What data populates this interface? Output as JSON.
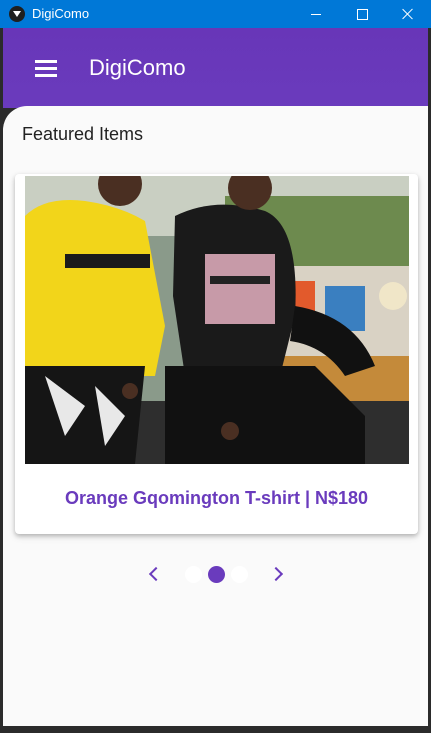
{
  "window": {
    "title": "DigiComo"
  },
  "appbar": {
    "title": "DigiComo",
    "menu_icon": "hamburger-menu-icon"
  },
  "section": {
    "title": "Featured Items"
  },
  "carousel": {
    "item_caption": "Orange Gqomington T-shirt | N$180",
    "total_dots": 3,
    "active_index": 1,
    "prev_icon": "chevron-left-icon",
    "next_icon": "chevron-right-icon"
  },
  "colors": {
    "titlebar": "#0078d7",
    "primary": "#6a3bbd",
    "background": "#fafafa"
  }
}
